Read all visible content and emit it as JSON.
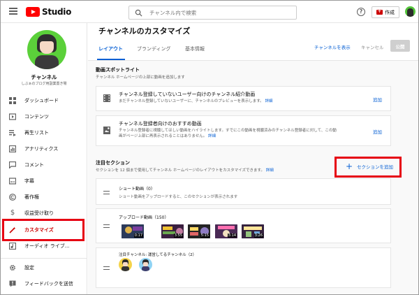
{
  "topbar": {
    "logo_text": "Studio",
    "search_placeholder": "チャンネル内で検索",
    "help_glyph": "?",
    "create_label": "作成"
  },
  "sidebar": {
    "channel_name": "チャンネル",
    "channel_sub": "しぶぁのブログ用副業置き場",
    "items": [
      {
        "label": "ダッシュボード",
        "icon": "dashboard-icon"
      },
      {
        "label": "コンテンツ",
        "icon": "content-icon"
      },
      {
        "label": "再生リスト",
        "icon": "playlist-icon"
      },
      {
        "label": "アナリティクス",
        "icon": "analytics-icon"
      },
      {
        "label": "コメント",
        "icon": "comment-icon"
      },
      {
        "label": "字幕",
        "icon": "subtitles-icon"
      },
      {
        "label": "著作権",
        "icon": "copyright-icon"
      },
      {
        "label": "収益受け取り",
        "icon": "dollar-icon"
      },
      {
        "label": "カスタマイズ",
        "icon": "magic-wand-icon",
        "active": true
      },
      {
        "label": "オーディオ ライブ...",
        "icon": "audio-library-icon"
      },
      {
        "label": "設定",
        "icon": "gear-icon"
      },
      {
        "label": "フィードバックを送信",
        "icon": "feedback-icon"
      }
    ]
  },
  "header": {
    "title": "チャンネルのカスタマイズ",
    "tabs": [
      "レイアウト",
      "ブランディング",
      "基本情報"
    ],
    "view_channel": "チャンネルを表示",
    "cancel": "キャンセル",
    "publish": "公開"
  },
  "spotlight": {
    "title": "動画スポットライト",
    "desc": "チャンネル ホームページの上部に動画を追加します",
    "cards": [
      {
        "title": "チャンネル登録していないユーザー向けのチャンネル紹介動画",
        "desc": "まだチャンネル登録していないユーザーに、チャンネルのプレビューを表示します。",
        "link": "詳細",
        "add": "追加"
      },
      {
        "title": "チャンネル登録者向けのおすすめ動画",
        "desc_line1": "チャンネル登録者に視聴してほしい動画をハイライトします。すでにこの動画を視聴済みのチャンネル登録者に対して、この動",
        "desc_line2": "画がページ上部に再表示されることはありません。",
        "link": "詳細",
        "add": "追加"
      }
    ]
  },
  "featured": {
    "title": "注目セクション",
    "desc": "セクションを 12 個まで使用してチャンネル ホームページのレイアウトをカスタマイズできます。",
    "link": "詳細",
    "add_section": "セクションを追加",
    "sections": [
      {
        "title": "ショート動画（0）",
        "desc": "ショート動画をアップロードすると、このセクションが表示されます"
      },
      {
        "title": "アップロード動画（150）"
      },
      {
        "title": "注目チャンネル: 運営してるチャンネル（2）"
      }
    ],
    "durations": [
      "0:17",
      "3:55",
      "5:15",
      "3:14",
      "3:26"
    ]
  },
  "colors": {
    "accent": "#065fd4",
    "brand_red": "#ff0000",
    "highlight": "#e60012"
  }
}
